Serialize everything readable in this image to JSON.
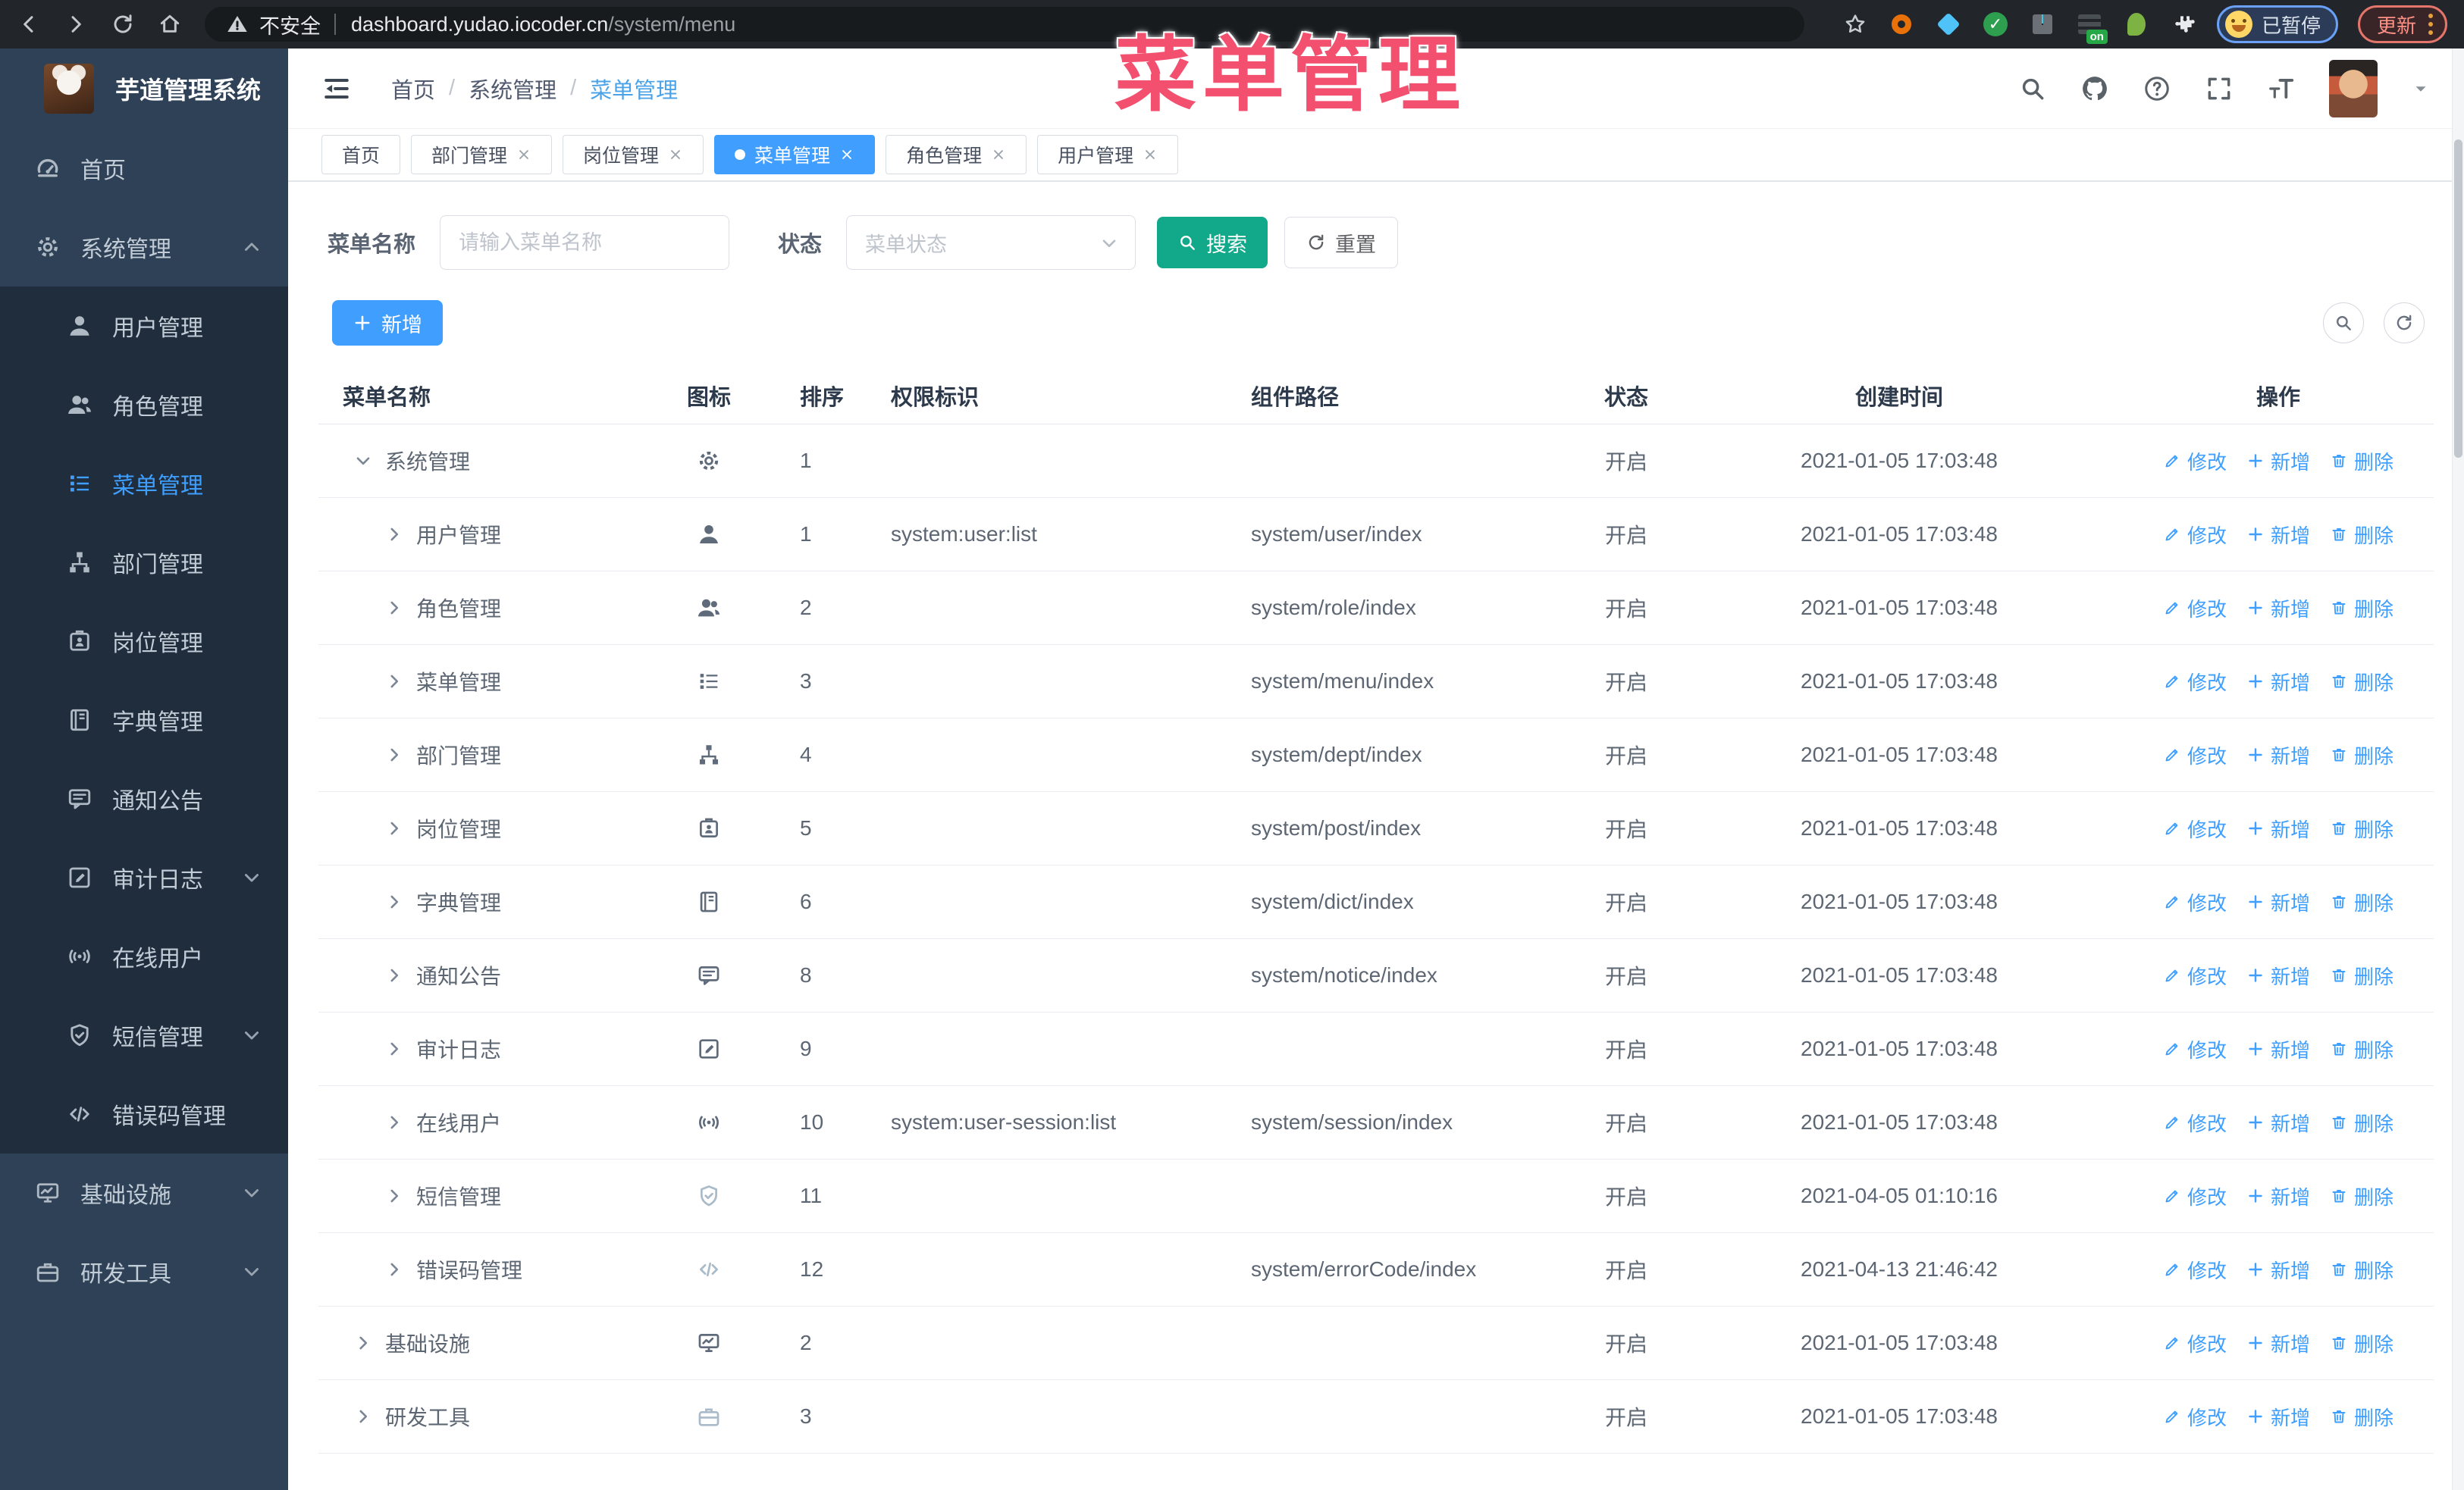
{
  "browser": {
    "security_label": "不安全",
    "url_host": "dashboard.yudao.iocoder.cn",
    "url_path": "/system/menu",
    "profile_status": "已暂停",
    "update_label": "更新",
    "extensions": [
      "orange-donut",
      "blue-gem",
      "green-check",
      "grid-squares",
      "stack-on",
      "green-leaf",
      "puzzle"
    ]
  },
  "overlay": {
    "text": "菜单管理"
  },
  "sidebar": {
    "logo_title": "芋道管理系统",
    "items": [
      {
        "label": "首页",
        "icon": "dashboard",
        "level": 0
      },
      {
        "label": "系统管理",
        "icon": "gear",
        "level": 0,
        "arrow": "up"
      },
      {
        "label": "用户管理",
        "icon": "user",
        "level": 1
      },
      {
        "label": "角色管理",
        "icon": "users",
        "level": 1
      },
      {
        "label": "菜单管理",
        "icon": "menu",
        "level": 1,
        "active": true
      },
      {
        "label": "部门管理",
        "icon": "tree",
        "level": 1
      },
      {
        "label": "岗位管理",
        "icon": "badge",
        "level": 1
      },
      {
        "label": "字典管理",
        "icon": "book",
        "level": 1
      },
      {
        "label": "通知公告",
        "icon": "message",
        "level": 1
      },
      {
        "label": "审计日志",
        "icon": "log",
        "level": 1,
        "arrow": "down"
      },
      {
        "label": "在线用户",
        "icon": "online",
        "level": 1
      },
      {
        "label": "短信管理",
        "icon": "shield",
        "level": 1,
        "arrow": "down"
      },
      {
        "label": "错误码管理",
        "icon": "code",
        "level": 1
      },
      {
        "label": "基础设施",
        "icon": "monitor",
        "level": 0,
        "arrow": "down"
      },
      {
        "label": "研发工具",
        "icon": "tool",
        "level": 0,
        "arrow": "down"
      }
    ]
  },
  "header": {
    "breadcrumb": [
      "首页",
      "系统管理",
      "菜单管理"
    ]
  },
  "tabs": [
    {
      "label": "首页",
      "closable": false
    },
    {
      "label": "部门管理",
      "closable": true
    },
    {
      "label": "岗位管理",
      "closable": true
    },
    {
      "label": "菜单管理",
      "closable": true,
      "active": true
    },
    {
      "label": "角色管理",
      "closable": true
    },
    {
      "label": "用户管理",
      "closable": true
    }
  ],
  "filters": {
    "name_label": "菜单名称",
    "name_placeholder": "请输入菜单名称",
    "status_label": "状态",
    "status_placeholder": "菜单状态",
    "search_label": "搜索",
    "reset_label": "重置"
  },
  "toolbar": {
    "add_label": "新增"
  },
  "table": {
    "columns": [
      "菜单名称",
      "图标",
      "排序",
      "权限标识",
      "组件路径",
      "状态",
      "创建时间",
      "操作"
    ],
    "action_labels": [
      "修改",
      "新增",
      "删除"
    ],
    "rows": [
      {
        "name": "系统管理",
        "icon": "gear",
        "level": 0,
        "expanded": true,
        "sort": "1",
        "permission": "",
        "path": "",
        "status": "开启",
        "created": "2021-01-05 17:03:48"
      },
      {
        "name": "用户管理",
        "icon": "user",
        "level": 1,
        "sort": "1",
        "permission": "system:user:list",
        "path": "system/user/index",
        "status": "开启",
        "created": "2021-01-05 17:03:48"
      },
      {
        "name": "角色管理",
        "icon": "users",
        "level": 1,
        "sort": "2",
        "permission": "",
        "path": "system/role/index",
        "status": "开启",
        "created": "2021-01-05 17:03:48"
      },
      {
        "name": "菜单管理",
        "icon": "menu",
        "level": 1,
        "sort": "3",
        "permission": "",
        "path": "system/menu/index",
        "status": "开启",
        "created": "2021-01-05 17:03:48"
      },
      {
        "name": "部门管理",
        "icon": "tree",
        "level": 1,
        "sort": "4",
        "permission": "",
        "path": "system/dept/index",
        "status": "开启",
        "created": "2021-01-05 17:03:48"
      },
      {
        "name": "岗位管理",
        "icon": "badge",
        "level": 1,
        "sort": "5",
        "permission": "",
        "path": "system/post/index",
        "status": "开启",
        "created": "2021-01-05 17:03:48"
      },
      {
        "name": "字典管理",
        "icon": "book",
        "level": 1,
        "sort": "6",
        "permission": "",
        "path": "system/dict/index",
        "status": "开启",
        "created": "2021-01-05 17:03:48"
      },
      {
        "name": "通知公告",
        "icon": "message",
        "level": 1,
        "sort": "8",
        "permission": "",
        "path": "system/notice/index",
        "status": "开启",
        "created": "2021-01-05 17:03:48"
      },
      {
        "name": "审计日志",
        "icon": "log",
        "level": 1,
        "sort": "9",
        "permission": "",
        "path": "",
        "status": "开启",
        "created": "2021-01-05 17:03:48"
      },
      {
        "name": "在线用户",
        "icon": "online",
        "level": 1,
        "sort": "10",
        "permission": "system:user-session:list",
        "path": "system/session/index",
        "status": "开启",
        "created": "2021-01-05 17:03:48"
      },
      {
        "name": "短信管理",
        "icon": "shield",
        "level": 1,
        "lite": true,
        "sort": "11",
        "permission": "",
        "path": "",
        "status": "开启",
        "created": "2021-04-05 01:10:16"
      },
      {
        "name": "错误码管理",
        "icon": "code",
        "level": 1,
        "lite": true,
        "sort": "12",
        "permission": "",
        "path": "system/errorCode/index",
        "status": "开启",
        "created": "2021-04-13 21:46:42"
      },
      {
        "name": "基础设施",
        "icon": "monitor",
        "level": 0,
        "sort": "2",
        "permission": "",
        "path": "",
        "status": "开启",
        "created": "2021-01-05 17:03:48"
      },
      {
        "name": "研发工具",
        "icon": "tool",
        "level": 0,
        "lite": true,
        "sort": "3",
        "permission": "",
        "path": "",
        "status": "开启",
        "created": "2021-01-05 17:03:48"
      }
    ]
  }
}
